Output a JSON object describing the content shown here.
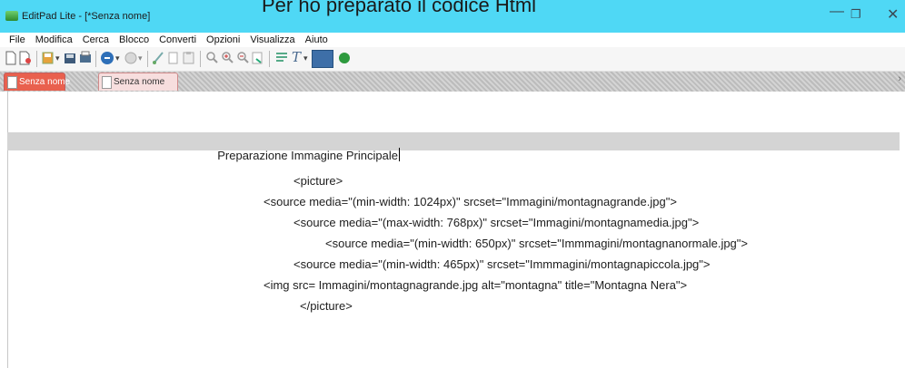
{
  "overlay_caption": "Per ho preparato il codice Html",
  "window": {
    "title": "EditPad Lite - [*Senza nome]",
    "controls": {
      "minimize": "—",
      "maximize": "❐",
      "close": "✕"
    }
  },
  "menu": [
    "File",
    "Modifica",
    "Cerca",
    "Blocco",
    "Converti",
    "Opzioni",
    "Visualizza",
    "Aiuto"
  ],
  "toolbar_icons": [
    "new-document-icon",
    "open-file-icon",
    "save-icon",
    "save-all-icon",
    "print-icon",
    "undo-icon",
    "redo-icon",
    "cut-icon",
    "copy-icon",
    "paste-icon",
    "find-icon",
    "zoom-in-icon",
    "zoom-out-icon",
    "replace-icon",
    "word-wrap-icon",
    "font-icon",
    "color-scheme-icon",
    "run-icon"
  ],
  "tabs": [
    {
      "label": "Senza nome",
      "active": false
    },
    {
      "label": "Senza nome",
      "active": true
    }
  ],
  "editor": {
    "heading": "Preparazione Immagine Principale",
    "lines": [
      "<picture>",
      "<source media=\"(min-width: 1024px)\" srcset=\"Immagini/montagnagrande.jpg\">",
      "<source media=\"(max-width: 768px)\" srcset=\"Immagini/montagnamedia.jpg\">",
      "<source media=\"(min-width: 650px)\" srcset=\"Immmagini/montagnanormale.jpg\">",
      "<source media=\"(min-width: 465px)\" srcset=\"Immmagini/montagnapiccola.jpg\">",
      "<img src= Immagini/montagnagrande.jpg alt=\"montagna\" title=\"Montagna Nera\">",
      "</picture>"
    ]
  },
  "colors": {
    "titlebar": "#4fd8f5",
    "active_tab": "#e9604e",
    "highlight_line": "#d4d4d4"
  }
}
